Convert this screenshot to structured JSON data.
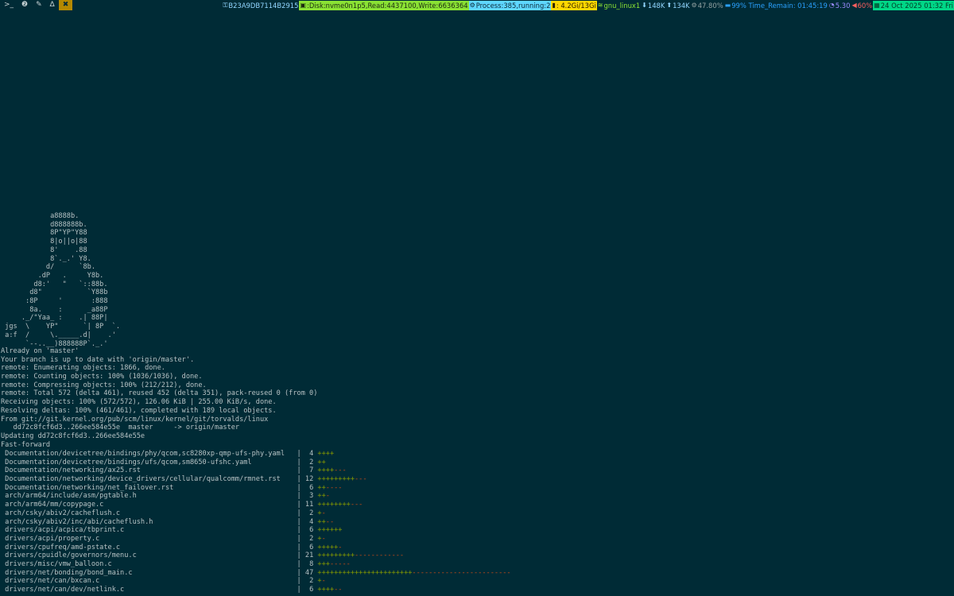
{
  "bar": {
    "tags": [
      {
        "name": "tag-terminal",
        "label": ">_",
        "active": false
      },
      {
        "name": "tag-2",
        "label": "❷",
        "active": false
      },
      {
        "name": "tag-editor",
        "label": "✎",
        "active": false
      },
      {
        "name": "tag-linux",
        "label": "∆",
        "active": false
      },
      {
        "name": "tag-tools",
        "label": "✖",
        "active": true
      }
    ],
    "status": [
      {
        "name": "status-hostid",
        "icon": "key-icon",
        "glyph": "⚿",
        "text": "B23A9DB7114B2915",
        "bg": "#002b36",
        "fg": "#93d6ff"
      },
      {
        "name": "status-disk",
        "icon": "disk-icon",
        "glyph": "▣",
        "text": ":Disk:nvme0n1p5,Read:4437100,Write:6636364",
        "bg": "#8ae234",
        "fg": "#1c2b10"
      },
      {
        "name": "status-process",
        "icon": "process-icon",
        "glyph": "⚙",
        "text": "Process:385,running:2",
        "bg": "#5fd7ff",
        "fg": "#0b2a36"
      },
      {
        "name": "status-memory",
        "icon": "memory-icon",
        "glyph": "▮",
        "text": ": 4.2Gi/13Gi",
        "bg": "#ffd700",
        "fg": "#2b2200"
      },
      {
        "name": "status-wifi",
        "icon": "wifi-icon",
        "glyph": "≋",
        "text": "gnu_linux1",
        "bg": "#002b36",
        "fg": "#8ae234"
      },
      {
        "name": "status-net-down",
        "icon": "arrow-down-icon",
        "glyph": "⬇",
        "text": "148K",
        "bg": "#002b36",
        "fg": "#93d6ff"
      },
      {
        "name": "status-net-up",
        "icon": "arrow-up-icon",
        "glyph": "⬆",
        "text": "134K",
        "bg": "#002b36",
        "fg": "#93d6ff"
      },
      {
        "name": "status-cpu",
        "icon": "cpu-icon",
        "glyph": "⚙",
        "text": "47.80%",
        "bg": "#002b36",
        "fg": "#93a1a1"
      },
      {
        "name": "status-battery",
        "icon": "battery-icon",
        "glyph": "▬",
        "text": "99% Time_Remain: 01:45:19",
        "bg": "#002b36",
        "fg": "#2aa1ff"
      },
      {
        "name": "status-load",
        "icon": "gauge-icon",
        "glyph": "◔",
        "text": "5.30",
        "bg": "#002b36",
        "fg": "#9b8cff"
      },
      {
        "name": "status-volume",
        "icon": "volume-icon",
        "glyph": "◀",
        "text": "60%",
        "bg": "#002b36",
        "fg": "#ff5f5f"
      },
      {
        "name": "status-datetime",
        "icon": "calendar-icon",
        "glyph": "▦",
        "text": "24 Oct 2025 01:32 Fri",
        "bg": "#00d787",
        "fg": "#003b26"
      }
    ]
  },
  "terminal": {
    "ascii_art": [
      "            a8888b.",
      "            d888888b.",
      "            8P\"YP\"Y88",
      "            8|o||o|88",
      "            8'    .88",
      "            8`._.' Y8.",
      "           d/      `8b.",
      "         .dP   .     Y8b.",
      "        d8:'   \"   `::88b.",
      "       d8\"           `Y88b",
      "      :8P     '       :888",
      "       8a.    :      _a88P",
      "     ._/\"Yaa_ :    .| 88P|",
      " jgs  \\    YP\"      `| 8P  `.",
      " a:f  /     \\._____.d|    .'",
      "      `--..__)888888P`._.'"
    ],
    "output_lines": [
      "Already on 'master'",
      "Your branch is up to date with 'origin/master'.",
      "remote: Enumerating objects: 1866, done.",
      "remote: Counting objects: 100% (1036/1036), done.",
      "remote: Compressing objects: 100% (212/212), done.",
      "remote: Total 572 (delta 461), reused 452 (delta 351), pack-reused 0 (from 0)",
      "Receiving objects: 100% (572/572), 126.06 KiB | 255.00 KiB/s, done.",
      "Resolving deltas: 100% (461/461), completed with 189 local objects.",
      "From git://git.kernel.org/pub/scm/linux/kernel/git/torvalds/linux",
      "   dd72c8fcf6d3..266ee584e55e  master     -> origin/master",
      "Updating dd72c8fcf6d3..266ee584e55e",
      "Fast-forward"
    ],
    "diffstat": [
      {
        "file": "Documentation/devicetree/bindings/phy/qcom,sc8280xp-qmp-ufs-phy.yaml",
        "count": "4",
        "plus": "++++",
        "minus": ""
      },
      {
        "file": "Documentation/devicetree/bindings/ufs/qcom,sm8650-ufshc.yaml",
        "count": "2",
        "plus": "++",
        "minus": ""
      },
      {
        "file": "Documentation/networking/ax25.rst",
        "count": "7",
        "plus": "++++",
        "minus": "---"
      },
      {
        "file": "Documentation/networking/device_drivers/cellular/qualcomm/rmnet.rst",
        "count": "12",
        "plus": "+++++++++",
        "minus": "---"
      },
      {
        "file": "Documentation/networking/net_failover.rst",
        "count": "6",
        "plus": "++",
        "minus": "----"
      },
      {
        "file": "arch/arm64/include/asm/pgtable.h",
        "count": "3",
        "plus": "++",
        "minus": "-"
      },
      {
        "file": "arch/arm64/mm/copypage.c",
        "count": "11",
        "plus": "++++++++",
        "minus": "---"
      },
      {
        "file": "arch/csky/abiv2/cacheflush.c",
        "count": "2",
        "plus": "+",
        "minus": "-"
      },
      {
        "file": "arch/csky/abiv2/inc/abi/cacheflush.h",
        "count": "4",
        "plus": "++",
        "minus": "--"
      },
      {
        "file": "drivers/acpi/acpica/tbprint.c",
        "count": "6",
        "plus": "++++++",
        "minus": ""
      },
      {
        "file": "drivers/acpi/property.c",
        "count": "2",
        "plus": "+",
        "minus": "-"
      },
      {
        "file": "drivers/cpufreq/amd-pstate.c",
        "count": "6",
        "plus": "+++++",
        "minus": "-"
      },
      {
        "file": "drivers/cpuidle/governors/menu.c",
        "count": "21",
        "plus": "+++++++++",
        "minus": "------------"
      },
      {
        "file": "drivers/misc/vmw_balloon.c",
        "count": "8",
        "plus": "+++",
        "minus": "-----"
      },
      {
        "file": "drivers/net/bonding/bond_main.c",
        "count": "47",
        "plus": "+++++++++++++++++++++++",
        "minus": "------------------------"
      },
      {
        "file": "drivers/net/can/bxcan.c",
        "count": "2",
        "plus": "+",
        "minus": "-"
      },
      {
        "file": "drivers/net/can/dev/netlink.c",
        "count": "6",
        "plus": "++++",
        "minus": "--"
      }
    ]
  }
}
